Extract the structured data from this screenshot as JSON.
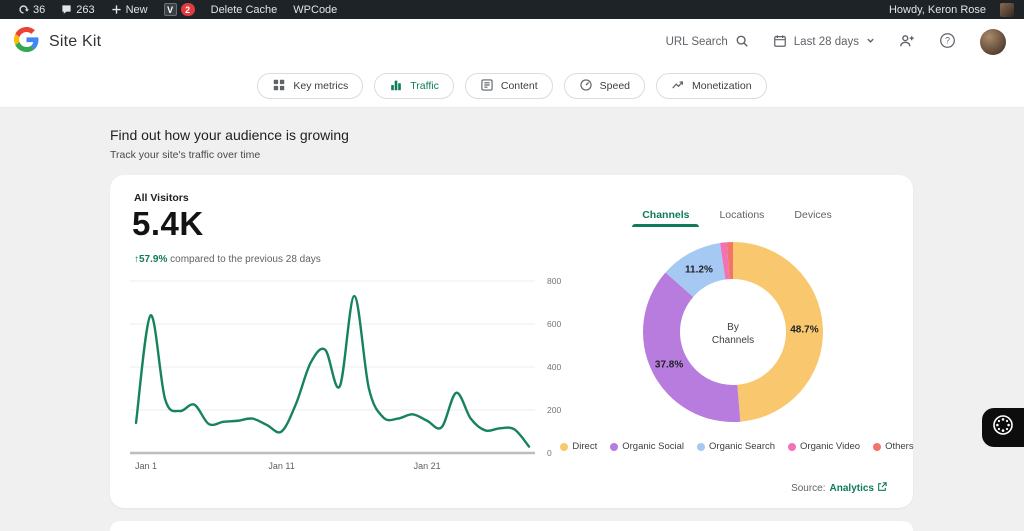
{
  "colors": {
    "accent": "#0F7B5C",
    "line": "#17835B",
    "badge_red": "#E13B3F"
  },
  "admin_bar": {
    "updates_count": "36",
    "comments_count": "263",
    "new_label": "New",
    "plugin_icon_letter": "V",
    "plugin_badge_count": "2",
    "delete_cache_label": "Delete Cache",
    "wpcode_label": "WPCode",
    "howdy": "Howdy, Keron Rose"
  },
  "header": {
    "app_title": "Site Kit",
    "url_search_label": "URL Search",
    "date_range_label": "Last 28 days"
  },
  "nav_tabs": [
    {
      "label": "Key metrics",
      "active": false
    },
    {
      "label": "Traffic",
      "active": true
    },
    {
      "label": "Content",
      "active": false
    },
    {
      "label": "Speed",
      "active": false
    },
    {
      "label": "Monetization",
      "active": false
    }
  ],
  "page": {
    "title": "Find out how your audience is growing",
    "subtitle": "Track your site's traffic over time"
  },
  "visitors_card": {
    "metric_label": "All Visitors",
    "metric_value": "5.4K",
    "change_arrow": "↑",
    "change_value": "57.9%",
    "change_text": "compared to the previous 28 days",
    "mini_tabs": [
      "Channels",
      "Locations",
      "Devices"
    ],
    "source_prefix": "Source:",
    "source_link": "Analytics"
  },
  "chart_data": [
    {
      "type": "line",
      "title": "All Visitors over time (last 28 days)",
      "x_unit": "day of January",
      "x": [
        1,
        2,
        3,
        4,
        5,
        6,
        7,
        8,
        9,
        10,
        11,
        12,
        13,
        14,
        15,
        16,
        17,
        18,
        19,
        20,
        21,
        22,
        23,
        24,
        25,
        26,
        27,
        28
      ],
      "values": [
        140,
        640,
        250,
        195,
        225,
        135,
        145,
        150,
        160,
        130,
        100,
        230,
        420,
        480,
        310,
        730,
        300,
        165,
        160,
        180,
        150,
        120,
        280,
        160,
        105,
        115,
        110,
        30
      ],
      "ylim": [
        0,
        800
      ],
      "yticks": [
        0,
        200,
        400,
        600,
        800
      ],
      "xticks": [
        {
          "index": 0,
          "label": "Jan 1"
        },
        {
          "index": 10,
          "label": "Jan 11"
        },
        {
          "index": 20,
          "label": "Jan 21"
        }
      ],
      "grid": true,
      "line_color": "#17835B"
    },
    {
      "type": "pie",
      "title": "By Channels",
      "center_label_line1": "By",
      "center_label_line2": "Channels",
      "label_threshold_pct": 5,
      "legend_position": "bottom",
      "segments": [
        {
          "label": "Direct",
          "value": 48.7,
          "color": "#F9C86E"
        },
        {
          "label": "Organic Social",
          "value": 37.8,
          "color": "#B77CDD"
        },
        {
          "label": "Organic Search",
          "value": 11.2,
          "color": "#A6C9F3"
        },
        {
          "label": "Organic Video",
          "value": 1.2,
          "color": "#F173B5"
        },
        {
          "label": "Others",
          "value": 1.1,
          "color": "#F2756C"
        }
      ]
    }
  ]
}
